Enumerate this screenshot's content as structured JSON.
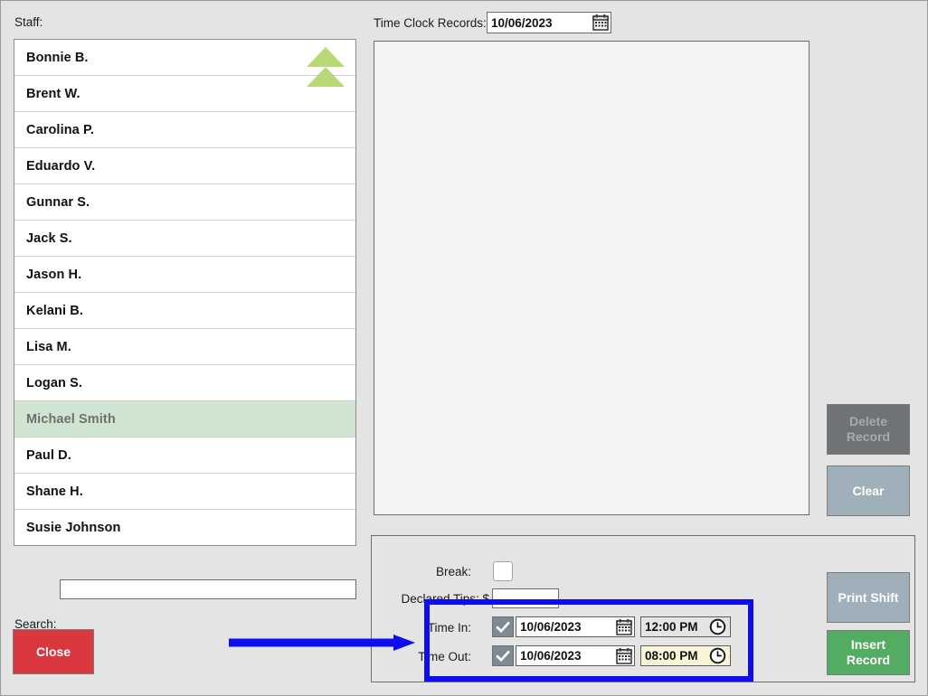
{
  "left": {
    "staff_label": "Staff:",
    "staff": [
      {
        "name": "Bonnie B.",
        "selected": false
      },
      {
        "name": "Brent W.",
        "selected": false
      },
      {
        "name": "Carolina P.",
        "selected": false
      },
      {
        "name": "Eduardo V.",
        "selected": false
      },
      {
        "name": "Gunnar S.",
        "selected": false
      },
      {
        "name": "Jack S.",
        "selected": false
      },
      {
        "name": "Jason H.",
        "selected": false
      },
      {
        "name": "Kelani B.",
        "selected": false
      },
      {
        "name": "Lisa M.",
        "selected": false
      },
      {
        "name": "Logan S.",
        "selected": false
      },
      {
        "name": "Michael Smith",
        "selected": true
      },
      {
        "name": "Paul D.",
        "selected": false
      },
      {
        "name": "Shane H.",
        "selected": false
      },
      {
        "name": "Susie Johnson",
        "selected": false
      }
    ],
    "scroll_up_icon": "double-chevron-up-icon",
    "search_label": "Search:",
    "search_value": "",
    "search_placeholder": "",
    "close_label": "Close"
  },
  "records": {
    "title_label": "Time Clock Records:",
    "date_value": "10/06/2023",
    "date_icon": "calendar-icon",
    "list_rows": [],
    "delete_label": "Delete\nRecord",
    "delete_line1": "Delete",
    "delete_line2": "Record",
    "delete_enabled": false,
    "clear_label": "Clear"
  },
  "detail": {
    "break_label": "Break:",
    "break_checked": false,
    "tips_label": "Declared Tips: $",
    "tips_value": "",
    "time_in": {
      "label": "Time In:",
      "checked": true,
      "date": "10/06/2023",
      "time": "12:00 PM",
      "date_icon": "calendar-icon",
      "time_icon": "clock-icon",
      "focused": false
    },
    "time_out": {
      "label": "Time Out:",
      "checked": true,
      "date": "10/06/2023",
      "time": "08:00 PM",
      "date_icon": "calendar-icon",
      "time_icon": "clock-icon",
      "focused": true
    },
    "print_label": "Print Shift",
    "insert_line1": "Insert",
    "insert_line2": "Record"
  },
  "annotation": {
    "color": "#0d0df0",
    "box_target": "time-in-out-group",
    "arrow_direction": "right"
  },
  "colors": {
    "window_bg": "#e4e4e4",
    "list_bg": "#ffffff",
    "selected_row": "#cfe5d2",
    "scroll_arrow_green": "#b9d877",
    "close_red": "#d9383f",
    "insert_green": "#53ac62",
    "button_blue_gray": "#9fb0bb",
    "disabled_gray": "#6f7376",
    "focus_field": "#f7f4d8",
    "annotation_blue": "#0d0df0"
  }
}
